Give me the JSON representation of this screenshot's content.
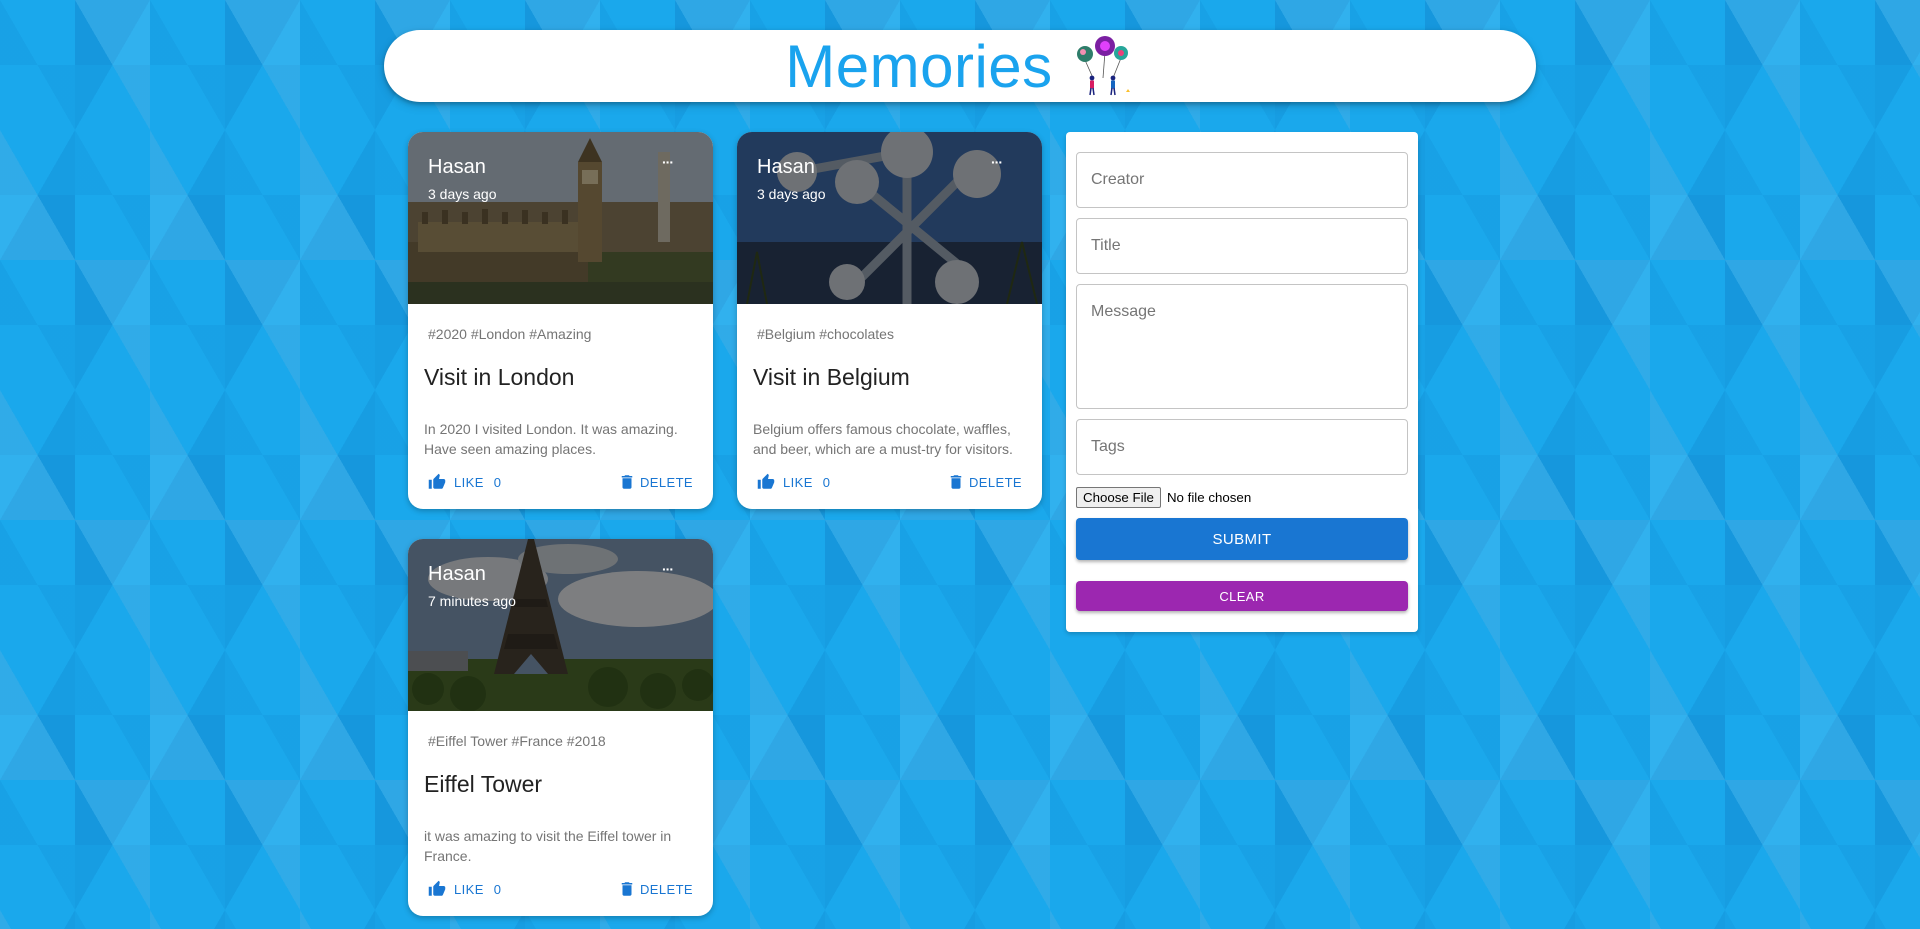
{
  "app": {
    "title": "Memories",
    "logo_icon": "balloons-people-icon",
    "accent": "#1aa3ee"
  },
  "posts": [
    {
      "creator": "Hasan",
      "time": "3 days ago",
      "more": "···",
      "tags": "#2020 #London #Amazing",
      "title": "Visit in London",
      "message": "In 2020 I visited London. It was amazing. Have seen amazing places.",
      "like_label": "LIKE",
      "like_count": "0",
      "delete_label": "DELETE"
    },
    {
      "creator": "Hasan",
      "time": "3 days ago",
      "more": "···",
      "tags": "#Belgium #chocolates",
      "title": "Visit in Belgium",
      "message": "Belgium offers famous chocolate, waffles, and beer, which are a must-try for visitors.",
      "like_label": "LIKE",
      "like_count": "0",
      "delete_label": "DELETE"
    },
    {
      "creator": "Hasan",
      "time": "7 minutes ago",
      "more": "···",
      "tags": "#Eiffel Tower #France #2018",
      "title": "Eiffel Tower",
      "message": "it was amazing to visit the Eiffel tower in France.",
      "like_label": "LIKE",
      "like_count": "0",
      "delete_label": "DELETE"
    }
  ],
  "form": {
    "creator_placeholder": "Creator",
    "title_placeholder": "Title",
    "message_placeholder": "Message",
    "tags_placeholder": "Tags",
    "file_button": "Choose File",
    "file_status": "No file chosen",
    "submit_label": "SUBMIT",
    "clear_label": "CLEAR",
    "submit_color": "#1976d2",
    "clear_color": "#9c27b0"
  }
}
